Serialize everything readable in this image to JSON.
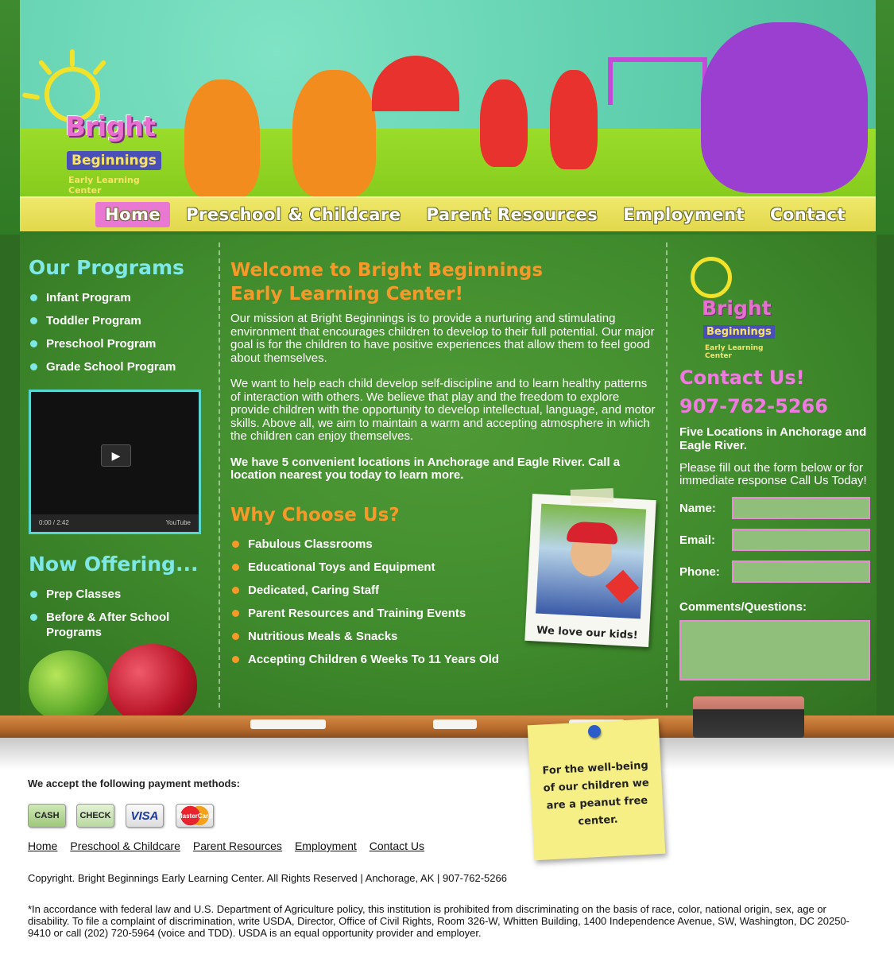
{
  "header": {
    "logo_top": "Bright",
    "logo_mid": "Beginnings",
    "logo_bottom": "Early Learning Center"
  },
  "nav": [
    {
      "label": "Home"
    },
    {
      "label": "Preschool & Childcare"
    },
    {
      "label": "Parent Resources"
    },
    {
      "label": "Employment"
    },
    {
      "label": "Contact"
    }
  ],
  "programs": {
    "title": "Our Programs",
    "items": [
      "Infant Program",
      "Toddler Program",
      "Preschool Program",
      "Grade School Program"
    ]
  },
  "video": {
    "time": "0:00 / 2:42",
    "brand": "YouTube"
  },
  "now_offering": {
    "title": "Now Offering...",
    "items": [
      "Prep Classes",
      "Before & After School Programs"
    ]
  },
  "welcome": {
    "title_line1": "Welcome to Bright Beginnings",
    "title_line2": "Early Learning Center!",
    "para1": "Our mission at Bright Beginnings is to provide a nurturing and stimulating environment that encourages children to develop to their full potential. Our major goal is for the children to have positive experiences that allow them to feel good about themselves.",
    "para2": "We want to help each child develop self-discipline and to learn healthy patterns of interaction with others. We believe that play and the freedom to explore provide children with the opportunity to develop intellectual, language, and motor skills. Above all, we aim to maintain a warm and accepting atmosphere in which the children can enjoy themselves.",
    "para3": "We have 5 convenient locations in Anchorage and Eagle River. Call a location nearest you today to learn more."
  },
  "why": {
    "title": "Why Choose Us?",
    "items": [
      "Fabulous Classrooms",
      "Educational Toys and Equipment",
      "Dedicated, Caring Staff",
      "Parent Resources and Training Events",
      "Nutritious Meals & Snacks",
      "Accepting Children 6 Weeks To 11 Years Old"
    ]
  },
  "polaroid_caption": "We love our kids!",
  "contact": {
    "title": "Contact Us!",
    "phone": "907-762-5266",
    "locations": "Five Locations in Anchorage and Eagle River.",
    "intro": "Please fill out the form below or for immediate response Call Us Today!",
    "name_label": "Name:",
    "email_label": "Email:",
    "phone_label": "Phone:",
    "comments_label": "Comments/Questions:"
  },
  "sticky": "For the well-being of our children we are a peanut free center.",
  "footer": {
    "pay_title": "We accept the following payment methods:",
    "payments": [
      "CASH",
      "CHECK",
      "VISA",
      "MasterCard"
    ],
    "links": [
      "Home",
      "Preschool & Childcare",
      "Parent Resources",
      "Employment",
      "Contact Us"
    ],
    "copyright": "Copyright. Bright Beginnings Early Learning Center. All Rights Reserved | Anchorage, AK | 907-762-5266",
    "legal": "*In accordance with federal law and U.S. Department of Agriculture policy, this institution is prohibited from discriminating on the basis of race, color, national origin, sex, age or disability. To file a complaint of discrimination, write USDA, Director, Office of Civil Rights, Room 326-W, Whitten Building, 1400 Independence Avenue, SW, Washington, DC 20250-9410 or call (202) 720-5964 (voice and TDD). USDA is an equal opportunity provider and employer."
  },
  "colors": {
    "cyan": "#7de8e6",
    "orange": "#f59a2a",
    "pink": "#f07be0",
    "board": "#3f8a2c"
  }
}
